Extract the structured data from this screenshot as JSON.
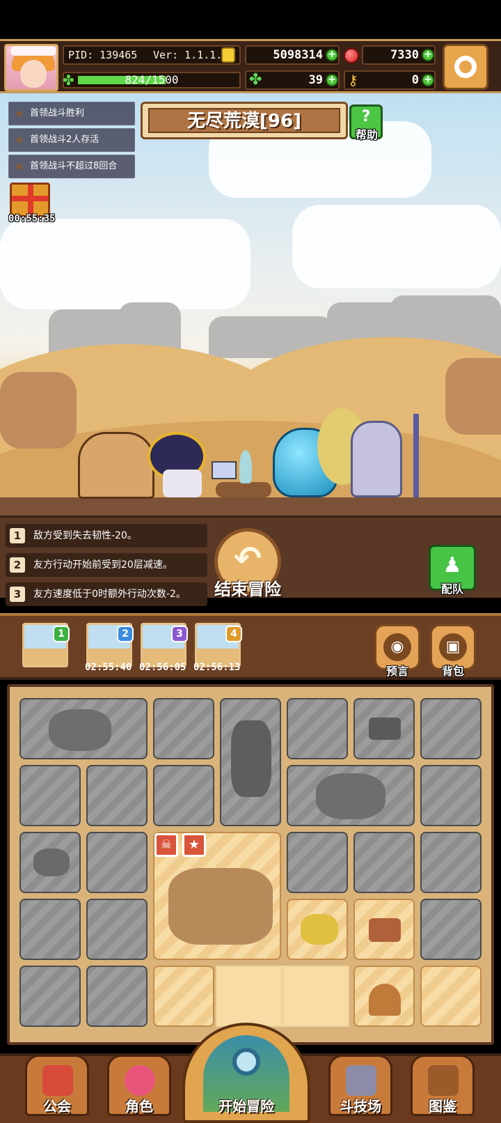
{
  "header": {
    "pid": "PID: 139465",
    "version": "Ver: 1.1.1.0",
    "gold": "5098314",
    "gems": "7330",
    "exp_text": "824/1500",
    "exp_fraction": 0.549,
    "clover": "39",
    "keys": "0"
  },
  "quests": [
    {
      "label": "首领战斗胜利"
    },
    {
      "label": "首领战斗2人存活"
    },
    {
      "label": "首领战斗不超过8回合"
    }
  ],
  "gift": {
    "timer": "00:55:35"
  },
  "stage": {
    "title": "无尽荒漠[96]",
    "help_label": "帮助"
  },
  "modifiers": [
    {
      "num": "1",
      "text": "敌方受到失去韧性-20。"
    },
    {
      "num": "2",
      "text": "友方行动开始前受到20层减速。"
    },
    {
      "num": "3",
      "text": "友方速度低于0时额外行动次数-2。"
    }
  ],
  "actions": {
    "end_label": "结束冒险",
    "team_label": "配队"
  },
  "map_queue": [
    {
      "badge": "1",
      "timer": ""
    },
    {
      "badge": "2",
      "timer": "02:55:40"
    },
    {
      "badge": "3",
      "timer": "02:56:05"
    },
    {
      "badge": "4",
      "timer": "02:56:13"
    }
  ],
  "side_buttons": {
    "prophecy": "预言",
    "bag": "背包"
  },
  "nav": {
    "guild": "公会",
    "character": "角色",
    "start": "开始冒险",
    "arena": "斗技场",
    "codex": "图鉴"
  },
  "colors": {
    "accent_green": "#4fc83a",
    "frame_brown": "#6b3f24",
    "badge_green": "#3cb043",
    "badge_blue": "#3a8be0",
    "badge_purple": "#8a58d0",
    "badge_orange": "#e09a2a"
  }
}
